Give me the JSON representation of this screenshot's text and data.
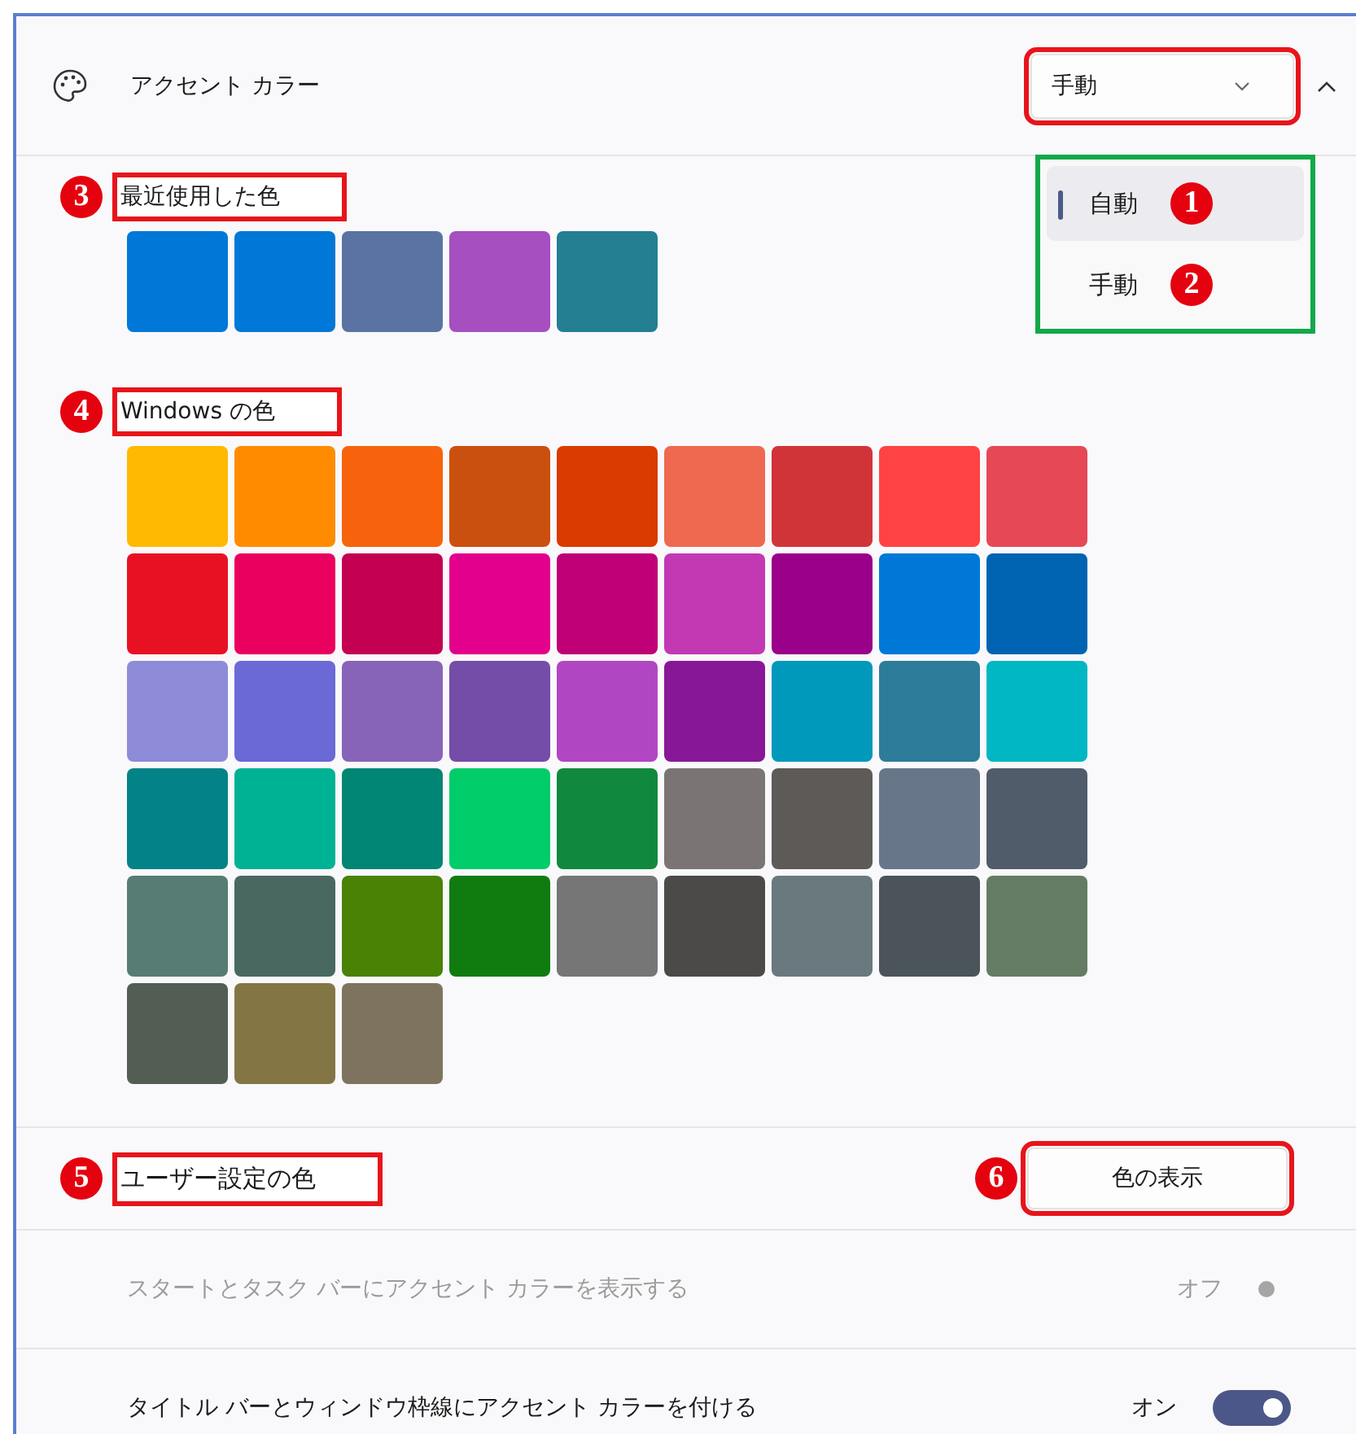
{
  "header": {
    "title": "アクセント カラー",
    "mode": {
      "value": "手動",
      "highlighted": true
    },
    "expanded": true
  },
  "mode_menu": {
    "highlighted": true,
    "items": [
      {
        "label": "自動",
        "selected": true,
        "badge": "1"
      },
      {
        "label": "手動",
        "selected": false,
        "badge": "2"
      }
    ]
  },
  "recent": {
    "label": "最近使用した色",
    "badge": "3",
    "highlighted": true,
    "colors": [
      {
        "color": "#0078d7"
      },
      {
        "color": "#0078d7"
      },
      {
        "color": "#5a73a3"
      },
      {
        "color": "#a64fc0"
      },
      {
        "color": "#237f91"
      }
    ]
  },
  "windows": {
    "label": "Windows の色",
    "badge": "4",
    "highlighted": true,
    "colors": [
      {
        "color": "#ffb900"
      },
      {
        "color": "#ff8c00"
      },
      {
        "color": "#f7630c"
      },
      {
        "color": "#ca5010"
      },
      {
        "color": "#da3b01"
      },
      {
        "color": "#ef6950"
      },
      {
        "color": "#d13438"
      },
      {
        "color": "#ff4343"
      },
      {
        "color": "#e74856"
      },
      {
        "color": "#e81123"
      },
      {
        "color": "#ea005e"
      },
      {
        "color": "#c30052"
      },
      {
        "color": "#e3008c"
      },
      {
        "color": "#bf0077"
      },
      {
        "color": "#c239b3"
      },
      {
        "color": "#9a0089"
      },
      {
        "color": "#0078d7"
      },
      {
        "color": "#0063b1"
      },
      {
        "color": "#8e8cd8"
      },
      {
        "color": "#6b69d6"
      },
      {
        "color": "#8764b8"
      },
      {
        "color": "#744da9"
      },
      {
        "color": "#b146c2"
      },
      {
        "color": "#881798"
      },
      {
        "color": "#0099bc"
      },
      {
        "color": "#2d7d9a"
      },
      {
        "color": "#00b7c3"
      },
      {
        "color": "#038387"
      },
      {
        "color": "#00b294"
      },
      {
        "color": "#018574"
      },
      {
        "color": "#00cc6a"
      },
      {
        "color": "#10893e"
      },
      {
        "color": "#7a7574"
      },
      {
        "color": "#5d5a58"
      },
      {
        "color": "#68768a"
      },
      {
        "color": "#515c6b"
      },
      {
        "color": "#567c73"
      },
      {
        "color": "#486860"
      },
      {
        "color": "#498205"
      },
      {
        "color": "#107c10"
      },
      {
        "color": "#767676"
      },
      {
        "color": "#4c4a48"
      },
      {
        "color": "#69797e"
      },
      {
        "color": "#4a5459"
      },
      {
        "color": "#647c64"
      },
      {
        "color": "#525e54"
      },
      {
        "color": "#847545"
      },
      {
        "color": "#7e735f"
      }
    ]
  },
  "custom": {
    "label": "ユーザー設定の色",
    "badge": "5",
    "highlighted": true,
    "button": {
      "label": "色の表示",
      "badge": "6",
      "highlighted": true
    }
  },
  "toggles": [
    {
      "label": "スタートとタスク バーにアクセント カラーを表示する",
      "state_text": "オフ",
      "on": false,
      "disabled": true
    },
    {
      "label": "タイトル バーとウィンドウ枠線にアクセント カラーを付ける",
      "state_text": "オン",
      "on": true,
      "disabled": false
    }
  ]
}
